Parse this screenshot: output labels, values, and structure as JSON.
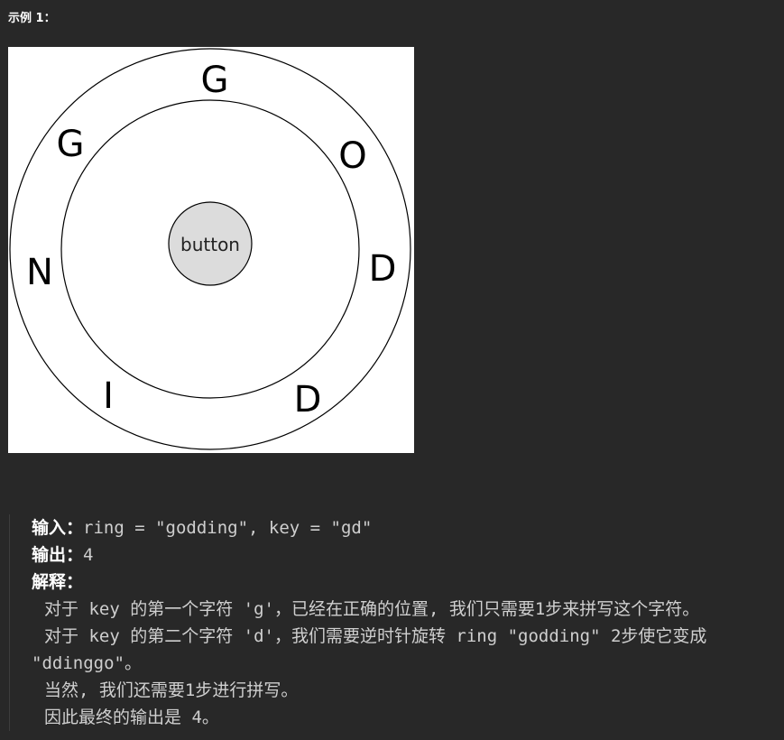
{
  "example": {
    "label": "示例 1："
  },
  "figure": {
    "ring_letters": [
      "G",
      "O",
      "D",
      "D",
      "I",
      "N",
      "G"
    ],
    "button_label": "button",
    "colors": {
      "background": "#ffffff",
      "stroke": "#000000",
      "button_fill": "#dcdcdc"
    }
  },
  "explanation_block": {
    "input_label": "输入：",
    "input_value": "ring = \"godding\", key = \"gd\"",
    "output_label": "输出：",
    "output_value": "4",
    "explain_label": "解释：",
    "lines": [
      "对于 key 的第一个字符 'g'，已经在正确的位置, 我们只需要1步来拼写这个字符。",
      "对于 key 的第二个字符 'd'，我们需要逆时针旋转 ring \"godding\" 2步使它变成",
      "\"ddinggo\"。",
      "当然, 我们还需要1步进行拼写。",
      "因此最终的输出是 4。"
    ]
  },
  "theme": {
    "page_bg": "#282828",
    "text": "#cfcfcf",
    "border": "#3d3d3d"
  }
}
